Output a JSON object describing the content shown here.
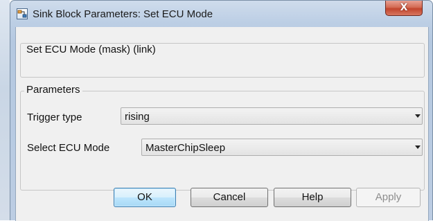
{
  "window": {
    "title": "Sink Block Parameters: Set ECU Mode",
    "close_glyph": "X",
    "app_icon": "simulink-block-icon"
  },
  "description_group": {
    "title": "Set ECU Mode (mask) (link)"
  },
  "parameters_group": {
    "title": "Parameters",
    "trigger_type": {
      "label": "Trigger type",
      "value": "rising"
    },
    "ecu_mode": {
      "label": "Select ECU Mode",
      "value": "MasterChipSleep"
    }
  },
  "buttons": {
    "ok": "OK",
    "cancel": "Cancel",
    "help": "Help",
    "apply": "Apply"
  },
  "colors": {
    "close_button": "#c2452d",
    "default_button_border": "#3c7fb1",
    "disabled_text": "#8d8d8d"
  }
}
